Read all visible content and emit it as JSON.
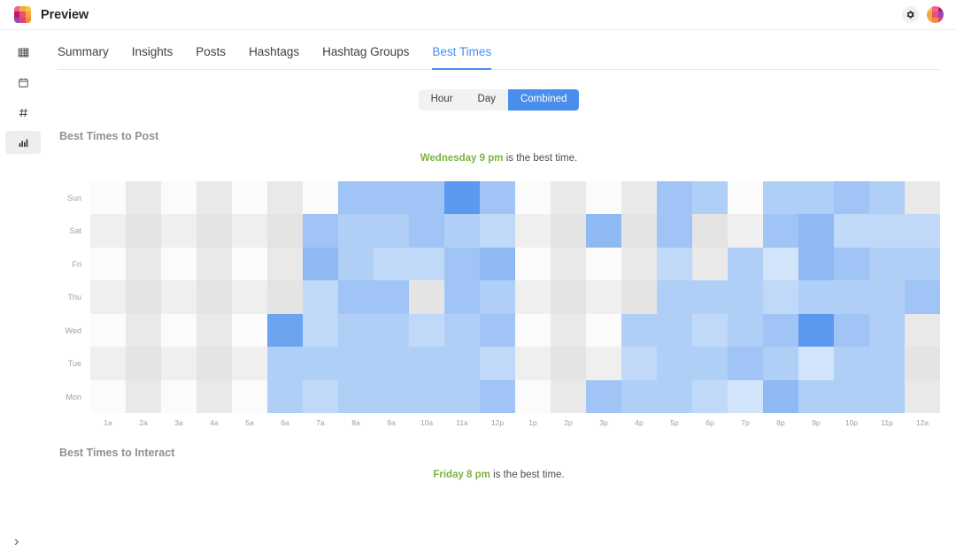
{
  "app": {
    "brand_name": "Preview",
    "logo_colors": [
      "#f06292",
      "#f2a93b",
      "#f6c344",
      "#c2185b",
      "#e94f7c",
      "#f4a63a",
      "#8e4bb5",
      "#e0447a",
      "#f08a3c"
    ],
    "avatar_colors": [
      "#f6c344",
      "#f06292",
      "#c2185b",
      "#f2a93b",
      "#e94f7c",
      "#8e4bb5",
      "#f4a63a",
      "#f08a3c",
      "#e0447a"
    ],
    "settings_icon": "gear-icon",
    "avatar_icon": "avatar-grid"
  },
  "sidebar": {
    "items": [
      {
        "name": "grid",
        "glyph": "▦",
        "active": false
      },
      {
        "name": "calendar",
        "glyph": "🗓",
        "active": false
      },
      {
        "name": "hashtag",
        "glyph": "#",
        "active": false
      },
      {
        "name": "analytics",
        "glyph": "▥",
        "active": true
      }
    ],
    "expand_glyph": "›"
  },
  "tabs": [
    {
      "label": "Summary",
      "active": false
    },
    {
      "label": "Insights",
      "active": false
    },
    {
      "label": "Posts",
      "active": false
    },
    {
      "label": "Hashtags",
      "active": false
    },
    {
      "label": "Hashtag Groups",
      "active": false
    },
    {
      "label": "Best Times",
      "active": true
    }
  ],
  "view_toggle": {
    "options": [
      {
        "label": "Hour",
        "active": false
      },
      {
        "label": "Day",
        "active": false
      },
      {
        "label": "Combined",
        "active": true
      }
    ]
  },
  "sections": {
    "post": {
      "title": "Best Times to Post",
      "best_when": "Wednesday 9 pm",
      "best_suffix": " is the best time."
    },
    "interact": {
      "title": "Best Times to Interact",
      "best_when": "Friday 8 pm",
      "best_suffix": " is the best time."
    }
  },
  "colors": {
    "accent": "#4a8eec",
    "best_time_green": "#7cb342",
    "empty_light": "#fbfbfb",
    "empty_dark": "#e9e9e9",
    "heat_min": "#e3effc",
    "heat_max": "#4a8eec"
  },
  "chart_data": {
    "type": "heatmap",
    "title": "Best Times to Post",
    "xlabel": "",
    "ylabel": "",
    "legend": "none",
    "grid": false,
    "note": "Engagement intensity per day-of-week / hour-of-day. Values 0-10; 0 = no data (rendered as neutral grey banding).",
    "x": [
      "1a",
      "2a",
      "3a",
      "4a",
      "5a",
      "6a",
      "7a",
      "8a",
      "9a",
      "10a",
      "11a",
      "12p",
      "1p",
      "2p",
      "3p",
      "4p",
      "5p",
      "6p",
      "7p",
      "8p",
      "9p",
      "10p",
      "11p",
      "12a"
    ],
    "y": [
      "Sun",
      "Sat",
      "Fri",
      "Thu",
      "Wed",
      "Tue",
      "Mon"
    ],
    "zrange": [
      0,
      10
    ],
    "values": [
      [
        0,
        0,
        0,
        0,
        0,
        0,
        0,
        5,
        5,
        5,
        9,
        5,
        0,
        0,
        0,
        0,
        5,
        4,
        0,
        4,
        4,
        5,
        4,
        0
      ],
      [
        0,
        0,
        0,
        0,
        0,
        0,
        5,
        4,
        4,
        5,
        4,
        3,
        0,
        0,
        6,
        0,
        5,
        0,
        0,
        5,
        6,
        3,
        3,
        3
      ],
      [
        0,
        0,
        0,
        0,
        0,
        0,
        6,
        4,
        3,
        3,
        5,
        6,
        0,
        0,
        0,
        0,
        3,
        0,
        4,
        2,
        6,
        5,
        4,
        4
      ],
      [
        0,
        0,
        0,
        0,
        0,
        0,
        3,
        5,
        5,
        0,
        5,
        4,
        0,
        0,
        0,
        0,
        4,
        4,
        4,
        3,
        4,
        4,
        4,
        5
      ],
      [
        0,
        0,
        0,
        0,
        0,
        8,
        3,
        4,
        4,
        3,
        4,
        5,
        0,
        0,
        0,
        4,
        4,
        3,
        4,
        5,
        9,
        5,
        4,
        0
      ],
      [
        0,
        0,
        0,
        0,
        0,
        4,
        4,
        4,
        4,
        4,
        4,
        3,
        0,
        0,
        0,
        3,
        4,
        4,
        5,
        4,
        2,
        4,
        4,
        0
      ],
      [
        0,
        0,
        0,
        0,
        0,
        4,
        3,
        4,
        4,
        4,
        4,
        5,
        0,
        0,
        5,
        4,
        4,
        3,
        2,
        6,
        4,
        4,
        4,
        0
      ]
    ]
  }
}
